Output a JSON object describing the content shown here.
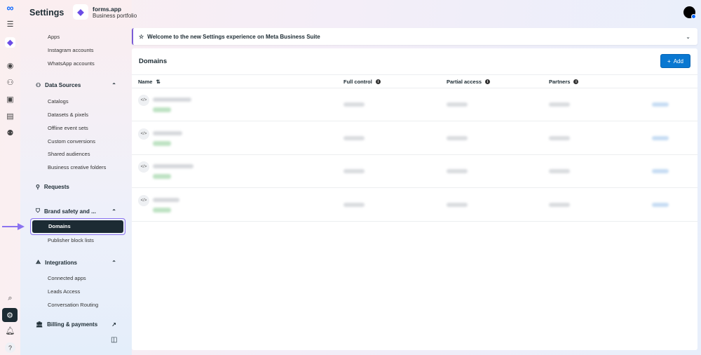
{
  "header": {
    "title": "Settings",
    "business_name": "forms.app",
    "business_type": "Business portfolio"
  },
  "rail": {
    "icons": [
      "meta-logo-icon",
      "menu-icon",
      "forms-app-icon",
      "account-icon",
      "people-icon",
      "pages-icon",
      "assets-icon",
      "partners-icon",
      "search-icon",
      "settings-icon",
      "notifications-icon",
      "help-icon"
    ]
  },
  "sidebar": {
    "top_items": [
      "Apps",
      "Instagram accounts",
      "WhatsApp accounts"
    ],
    "data_sources": {
      "label": "Data Sources",
      "items": [
        "Catalogs",
        "Datasets & pixels",
        "Offline event sets",
        "Custom conversions",
        "Shared audiences",
        "Business creative folders"
      ]
    },
    "requests": "Requests",
    "brand_safety": {
      "label": "Brand safety and ...",
      "items": [
        "Domains",
        "Publisher block lists"
      ],
      "active": "Domains"
    },
    "integrations": {
      "label": "Integrations",
      "items": [
        "Connected apps",
        "Leads Access",
        "Conversation Routing"
      ]
    },
    "billing": "Billing & payments"
  },
  "banner": {
    "text": "Welcome to the new Settings experience on Meta Business Suite"
  },
  "main": {
    "title": "Domains",
    "add_label": "Add",
    "columns": [
      "Name",
      "Full control",
      "Partial access",
      "Partners"
    ],
    "rows_note_blurred": 4
  },
  "colors": {
    "accent": "#0a78d1",
    "active_bg": "#1c2b33",
    "highlight": "#8b73f0"
  }
}
